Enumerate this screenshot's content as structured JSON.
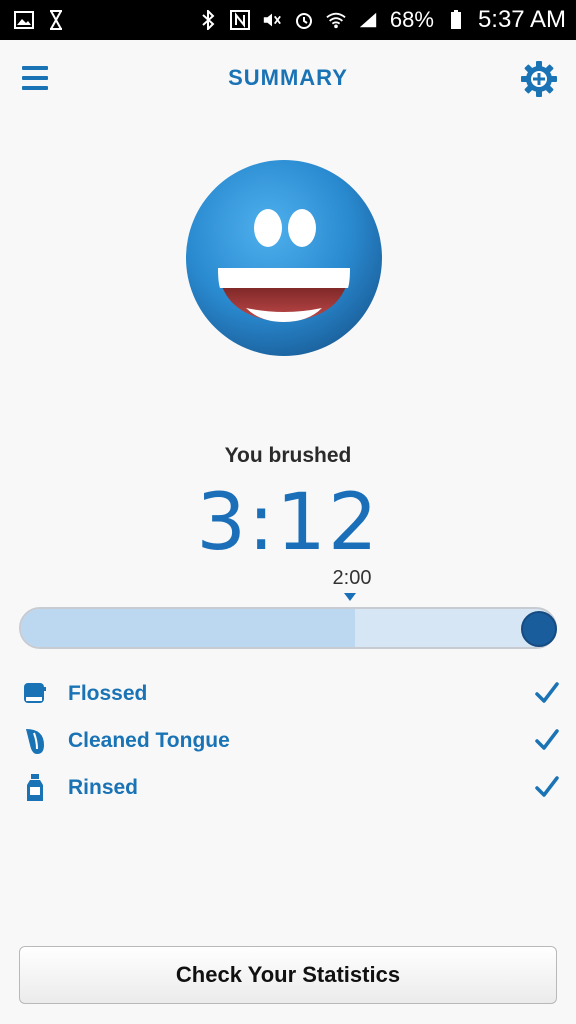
{
  "status_bar": {
    "battery": "68%",
    "time": "5:37 AM",
    "icons": [
      "gallery-icon",
      "hourglass-icon",
      "bluetooth-icon",
      "nfc-icon",
      "mute-icon",
      "alarm-icon",
      "wifi-icon",
      "lte-icon",
      "signal-icon",
      "battery-icon"
    ]
  },
  "header": {
    "title": "SUMMARY",
    "left_icon": "menu-icon",
    "right_icon": "settings-gear-icon"
  },
  "summary": {
    "mood_icon": "smiley-face-icon",
    "brushed_label": "You brushed",
    "brushed_time": "3:12",
    "target_time": "2:00",
    "progress_fraction": 1.0,
    "target_fraction": 0.625
  },
  "checklist": [
    {
      "label": "Flossed",
      "icon": "floss-icon",
      "checked": true
    },
    {
      "label": "Cleaned Tongue",
      "icon": "tongue-icon",
      "checked": true
    },
    {
      "label": "Rinsed",
      "icon": "rinse-bottle-icon",
      "checked": true
    }
  ],
  "actions": {
    "stats_button": "Check Your Statistics"
  },
  "colors": {
    "accent": "#1a73b5",
    "timer": "#1b6fb8",
    "knob": "#1a5d9c",
    "smiley": "#2e8fd6"
  }
}
